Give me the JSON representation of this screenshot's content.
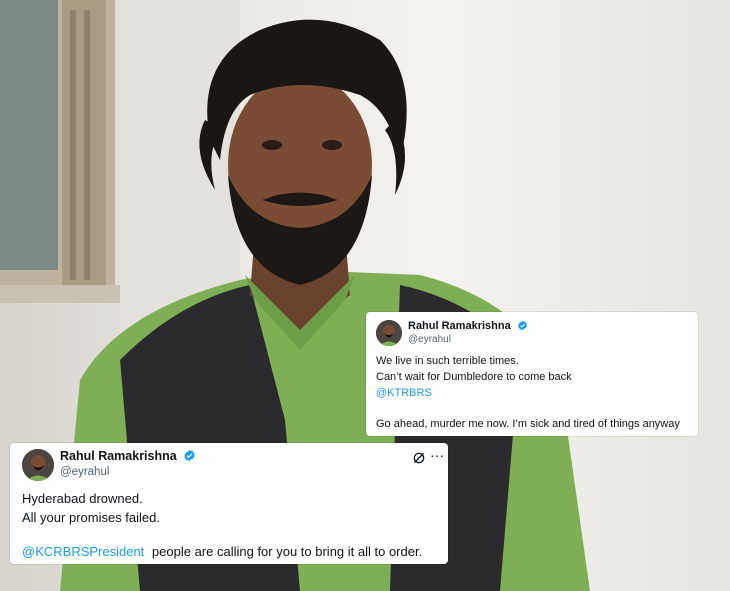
{
  "tweets": [
    {
      "author": "Rahul Ramakrishna",
      "handle": "@eyrahul",
      "lines": [
        "We live in such terrible times.",
        "Can’t wait for Dumbledore to come back"
      ],
      "mention": "@KTRBRS",
      "closing": "Go ahead, murder me now. I’m sick and tired of things anyway"
    },
    {
      "author": "Rahul Ramakrishna",
      "handle": "@eyrahul",
      "lines": [
        "Hyderabad drowned.",
        "All your promises failed."
      ],
      "mention": "@KCRBRSPresident",
      "after_mention": "people are calling for you to bring it all to order.",
      "more": "···"
    }
  ],
  "colors": {
    "verified": "#1d9bf0",
    "mention": "#1d9bf0",
    "text": "#0f1419",
    "handle": "#536471",
    "shirt": "#7fae55",
    "vest": "#2b2b2d"
  },
  "icons": [
    "verified-badge-icon",
    "grok-icon",
    "more-options-icon",
    "avatar-photo"
  ]
}
